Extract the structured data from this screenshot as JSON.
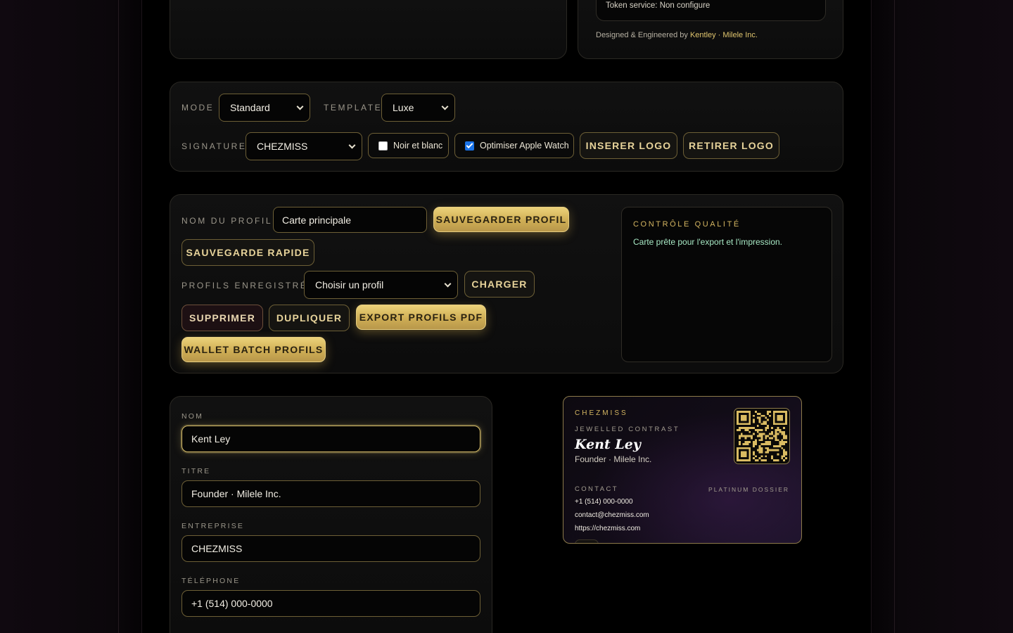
{
  "top": {
    "token_status": "Token service: Non configure",
    "credit_prefix": "Designed & Engineered by",
    "credit_author": "Kentley · Milele Inc."
  },
  "settings": {
    "mode_label": "MODE",
    "mode_value": "Standard",
    "template_label": "TEMPLATE",
    "template_value": "Luxe",
    "signature_label": "SIGNATURE",
    "signature_value": "CHEZMISS",
    "bw_label": "Noir et blanc",
    "bw_checked": false,
    "watch_label": "Optimiser Apple Watch",
    "watch_checked": true,
    "insert_logo": "INSERER LOGO",
    "remove_logo": "RETIRER LOGO"
  },
  "profiles": {
    "name_label": "NOM DU PROFIL",
    "name_value": "Carte principale",
    "save_profile": "SAUVEGARDER PROFIL",
    "quick_save": "SAUVEGARDE RAPIDE",
    "saved_label": "PROFILS ENREGISTRÉS",
    "saved_placeholder": "Choisir un profil",
    "load": "CHARGER",
    "delete": "SUPPRIMER",
    "duplicate": "DUPLIQUER",
    "export_pdf": "EXPORT PROFILS PDF",
    "wallet_batch": "WALLET BATCH PROFILS"
  },
  "quality": {
    "title": "CONTRÔLE QUALITÉ",
    "message": "Carte prête pour l'export et l'impression."
  },
  "form": {
    "nom_label": "NOM",
    "nom_value": "Kent Ley",
    "titre_label": "TITRE",
    "titre_value": "Founder · Milele Inc.",
    "entreprise_label": "ENTREPRISE",
    "entreprise_value": "CHEZMISS",
    "telephone_label": "TÉLÉPHONE",
    "telephone_value": "+1 (514) 000-0000"
  },
  "card": {
    "brand": "CHEZMISS",
    "template_name": "JEWELLED CONTRAST",
    "name": "Kent Ley",
    "title": "Founder · Milele Inc.",
    "contact_label": "CONTACT",
    "tier": "PLATINUM DOSSIER",
    "phone": "+1 (514) 000-0000",
    "email": "contact@chezmiss.com",
    "website": "https://chezmiss.com"
  },
  "colors": {
    "gold": "#e0c56e",
    "panel_border": "#2a2823",
    "accent_green": "#a7e8c4"
  }
}
